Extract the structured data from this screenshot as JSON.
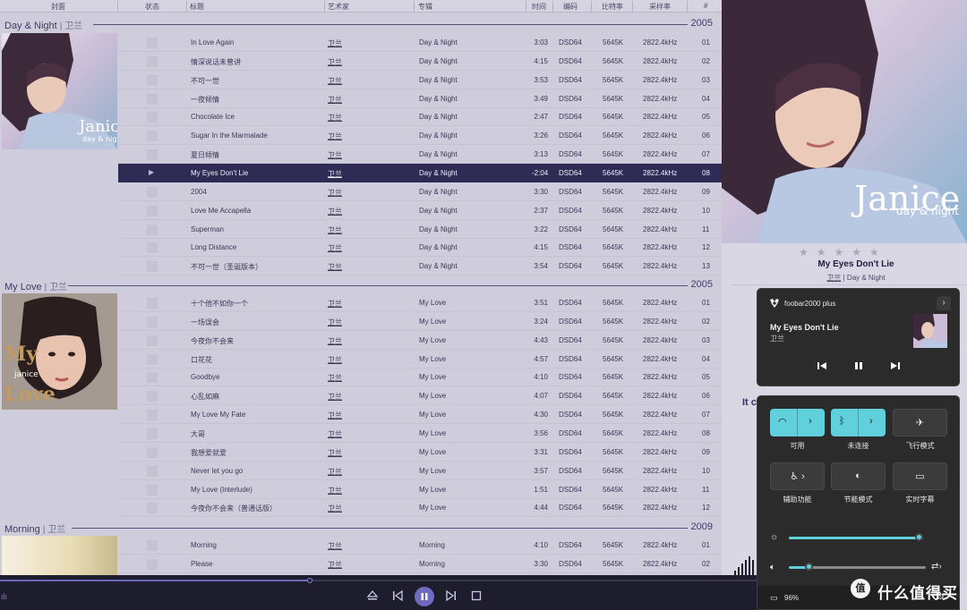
{
  "columns": {
    "cover": "封面",
    "status": "状态",
    "title": "标题",
    "artist": "艺术家",
    "album": "专辑",
    "time": "时间",
    "codec": "编码",
    "bitrate": "比特率",
    "samplerate": "采样率",
    "num": "#"
  },
  "groups": [
    {
      "album": "Day & Night",
      "artist": "卫兰",
      "year": "2005",
      "tracks": [
        {
          "title": "In Love Again",
          "artist": "卫兰",
          "album": "Day & Night",
          "time": "3:03",
          "codec": "DSD64",
          "bitrate": "5645K",
          "rate": "2822.4kHz",
          "num": "01"
        },
        {
          "title": "情深说话未曾讲",
          "artist": "卫兰",
          "album": "Day & Night",
          "time": "4:15",
          "codec": "DSD64",
          "bitrate": "5645K",
          "rate": "2822.4kHz",
          "num": "02"
        },
        {
          "title": "不可一世",
          "artist": "卫兰",
          "album": "Day & Night",
          "time": "3:53",
          "codec": "DSD64",
          "bitrate": "5645K",
          "rate": "2822.4kHz",
          "num": "03"
        },
        {
          "title": "一夜倾情",
          "artist": "卫兰",
          "album": "Day & Night",
          "time": "3:49",
          "codec": "DSD64",
          "bitrate": "5645K",
          "rate": "2822.4kHz",
          "num": "04"
        },
        {
          "title": "Chocolate Ice",
          "artist": "卫兰",
          "album": "Day & Night",
          "time": "2:47",
          "codec": "DSD64",
          "bitrate": "5645K",
          "rate": "2822.4kHz",
          "num": "05"
        },
        {
          "title": "Sugar In the Marmalade",
          "artist": "卫兰",
          "album": "Day & Night",
          "time": "3:26",
          "codec": "DSD64",
          "bitrate": "5645K",
          "rate": "2822.4kHz",
          "num": "06"
        },
        {
          "title": "夏日倾情",
          "artist": "卫兰",
          "album": "Day & Night",
          "time": "3:13",
          "codec": "DSD64",
          "bitrate": "5645K",
          "rate": "2822.4kHz",
          "num": "07"
        },
        {
          "title": "My Eyes Don't Lie",
          "artist": "卫兰",
          "album": "Day & Night",
          "time": "-2:04",
          "codec": "DSD64",
          "bitrate": "5645K",
          "rate": "2822.4kHz",
          "num": "08",
          "playing": true
        },
        {
          "title": "2004",
          "artist": "卫兰",
          "album": "Day & Night",
          "time": "3:30",
          "codec": "DSD64",
          "bitrate": "5645K",
          "rate": "2822.4kHz",
          "num": "09"
        },
        {
          "title": "Love Me Accapella",
          "artist": "卫兰",
          "album": "Day & Night",
          "time": "2:37",
          "codec": "DSD64",
          "bitrate": "5645K",
          "rate": "2822.4kHz",
          "num": "10"
        },
        {
          "title": "Superman",
          "artist": "卫兰",
          "album": "Day & Night",
          "time": "3:22",
          "codec": "DSD64",
          "bitrate": "5645K",
          "rate": "2822.4kHz",
          "num": "11"
        },
        {
          "title": "Long Distance",
          "artist": "卫兰",
          "album": "Day & Night",
          "time": "4:15",
          "codec": "DSD64",
          "bitrate": "5645K",
          "rate": "2822.4kHz",
          "num": "12"
        },
        {
          "title": "不可一世（圣诞版本）",
          "artist": "卫兰",
          "album": "Day & Night",
          "time": "3:54",
          "codec": "DSD64",
          "bitrate": "5645K",
          "rate": "2822.4kHz",
          "num": "13"
        }
      ]
    },
    {
      "album": "My Love",
      "artist": "卫兰",
      "year": "2005",
      "tracks": [
        {
          "title": "十个他不如你一个",
          "artist": "卫兰",
          "album": "My Love",
          "time": "3:51",
          "codec": "DSD64",
          "bitrate": "5645K",
          "rate": "2822.4kHz",
          "num": "01"
        },
        {
          "title": "一场误会",
          "artist": "卫兰",
          "album": "My Love",
          "time": "3:24",
          "codec": "DSD64",
          "bitrate": "5645K",
          "rate": "2822.4kHz",
          "num": "02"
        },
        {
          "title": "今夜你不会来",
          "artist": "卫兰",
          "album": "My Love",
          "time": "4:43",
          "codec": "DSD64",
          "bitrate": "5645K",
          "rate": "2822.4kHz",
          "num": "03"
        },
        {
          "title": "口花花",
          "artist": "卫兰",
          "album": "My Love",
          "time": "4:57",
          "codec": "DSD64",
          "bitrate": "5645K",
          "rate": "2822.4kHz",
          "num": "04"
        },
        {
          "title": "Goodbye",
          "artist": "卫兰",
          "album": "My Love",
          "time": "4:10",
          "codec": "DSD64",
          "bitrate": "5645K",
          "rate": "2822.4kHz",
          "num": "05"
        },
        {
          "title": "心乱如麻",
          "artist": "卫兰",
          "album": "My Love",
          "time": "4:07",
          "codec": "DSD64",
          "bitrate": "5645K",
          "rate": "2822.4kHz",
          "num": "06"
        },
        {
          "title": "My Love My Fate",
          "artist": "卫兰",
          "album": "My Love",
          "time": "4:30",
          "codec": "DSD64",
          "bitrate": "5645K",
          "rate": "2822.4kHz",
          "num": "07"
        },
        {
          "title": "大哥",
          "artist": "卫兰",
          "album": "My Love",
          "time": "3:56",
          "codec": "DSD64",
          "bitrate": "5645K",
          "rate": "2822.4kHz",
          "num": "08"
        },
        {
          "title": "我想爱就爱",
          "artist": "卫兰",
          "album": "My Love",
          "time": "3:31",
          "codec": "DSD64",
          "bitrate": "5645K",
          "rate": "2822.4kHz",
          "num": "09"
        },
        {
          "title": "Never let you go",
          "artist": "卫兰",
          "album": "My Love",
          "time": "3:57",
          "codec": "DSD64",
          "bitrate": "5645K",
          "rate": "2822.4kHz",
          "num": "10"
        },
        {
          "title": "My Love (Interlude)",
          "artist": "卫兰",
          "album": "My Love",
          "time": "1:51",
          "codec": "DSD64",
          "bitrate": "5645K",
          "rate": "2822.4kHz",
          "num": "11"
        },
        {
          "title": "今夜你不会来（普通话版）",
          "artist": "卫兰",
          "album": "My Love",
          "time": "4:44",
          "codec": "DSD64",
          "bitrate": "5645K",
          "rate": "2822.4kHz",
          "num": "12"
        }
      ]
    },
    {
      "album": "Morning",
      "artist": "卫兰",
      "year": "2009",
      "tracks": [
        {
          "title": "Morning",
          "artist": "卫兰",
          "album": "Morning",
          "time": "4:10",
          "codec": "DSD64",
          "bitrate": "5645K",
          "rate": "2822.4kHz",
          "num": "01"
        },
        {
          "title": "Please",
          "artist": "卫兰",
          "album": "Morning",
          "time": "3:30",
          "codec": "DSD64",
          "bitrate": "5645K",
          "rate": "2822.4kHz",
          "num": "02"
        }
      ]
    }
  ],
  "cover_text": {
    "day_night_1": "Janice",
    "day_night_2": "day & night",
    "my_love_1": "My",
    "my_love_2": "janice",
    "my_love_3": "Love"
  },
  "now_playing": {
    "title": "My Eyes Don't Lie",
    "artist": "卫兰",
    "separator": "|",
    "album": "Day & Night",
    "rating": "★★★★★",
    "lyric": "It c"
  },
  "media_flyout": {
    "app": "foobar2000 plus",
    "title": "My Eyes Don't Lie",
    "artist": "卫兰",
    "icons": [
      "previous-icon",
      "pause-icon",
      "next-icon",
      "chevron-right-icon"
    ]
  },
  "quick_settings": {
    "tiles": [
      {
        "label": "可用",
        "icon": "wifi-icon",
        "on": true
      },
      {
        "label": "未连接",
        "icon": "bluetooth-icon",
        "on": true
      },
      {
        "label": "飞行模式",
        "icon": "airplane-icon",
        "on": false
      },
      {
        "label": "辅助功能",
        "icon": "accessibility-icon",
        "on": false
      },
      {
        "label": "节能模式",
        "icon": "battery-saver-icon",
        "on": false
      },
      {
        "label": "实时字幕",
        "icon": "live-captions-icon",
        "on": false
      }
    ],
    "brightness": 0.97,
    "volume": 0.15,
    "battery": "96%"
  },
  "playback": {
    "progress": 0.41
  },
  "watermark": {
    "badge": "值",
    "text": "什么值得买"
  },
  "colors": {
    "accent": "#5fd0dc",
    "selection": "#2e2b55",
    "seek": "#6b66b8"
  }
}
